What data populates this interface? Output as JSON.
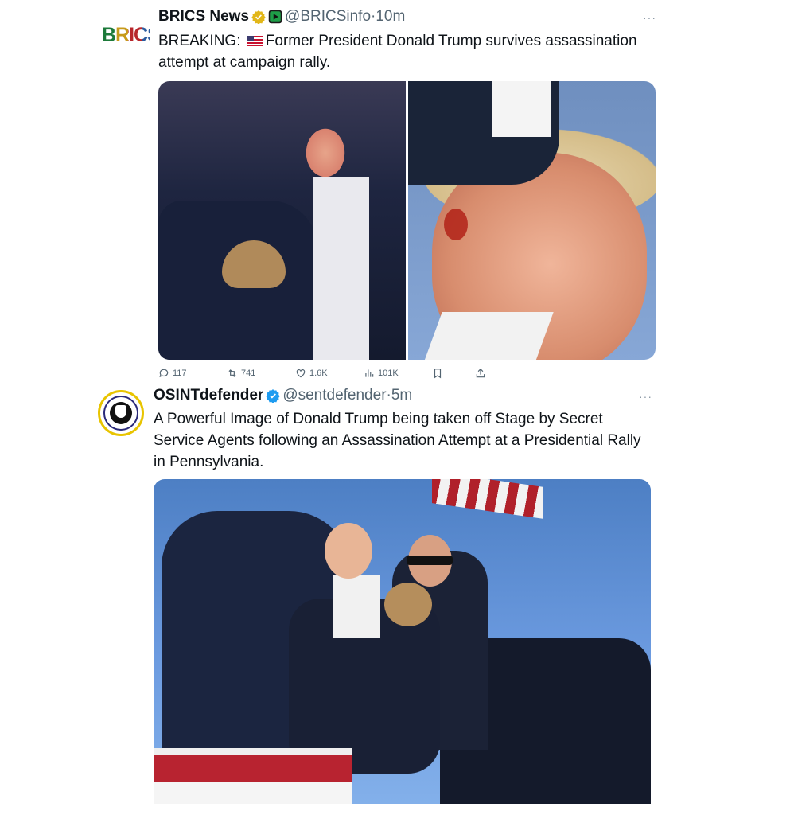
{
  "tweets": [
    {
      "name": "BRICS News",
      "handle": "@BRICSinfo",
      "sep": "·",
      "time": "10m",
      "avatar_text": "BRICS",
      "text_prefix": "BREAKING:",
      "flag_icon": "us-flag-emoji",
      "text_body": "Former President Donald Trump survives assassination attempt at campaign rally.",
      "more": "···",
      "actions": {
        "replies": "117",
        "retweets": "741",
        "likes": "1.6K",
        "views": "101K"
      }
    },
    {
      "name": "OSINTdefender",
      "handle": "@sentdefender",
      "sep": "·",
      "time": "5m",
      "text": "A Powerful Image of Donald Trump being taken off Stage by Secret Service Agents following an Assassination Attempt at a Presidential Rally in Pennsylvania.",
      "more": "···"
    }
  ],
  "colors": {
    "verified_gold": "#e2b719",
    "verified_blue": "#1d9bf0",
    "text_secondary": "#536471"
  }
}
